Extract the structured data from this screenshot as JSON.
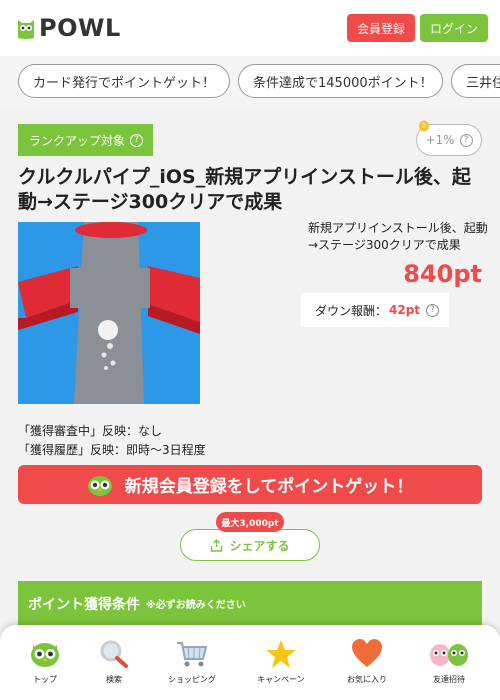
{
  "header": {
    "logo_text": "POWL",
    "register_label": "会員登録",
    "login_label": "ログイン"
  },
  "campaigns": [
    "カード発行でポイントゲット！",
    "条件達成で145000ポイント！",
    "三井住"
  ],
  "offer": {
    "rank_badge": "ランクアップ対象",
    "bonus_pill": "+1%",
    "title": "クルクルパイプ_iOS_新規アプリインストール後、起動→ステージ300クリアで成果",
    "description": "新規アプリインストール後、起動→ステージ300クリアで成果",
    "points": "840pt",
    "down_label": "ダウン報酬：",
    "down_value": "42pt",
    "status_pending": "「獲得審査中」反映：なし",
    "status_history": "「獲得履歴」反映：即時〜3日程度",
    "cta_label": "新規会員登録をしてポイントゲット！",
    "share_badge": "最大3,000pt",
    "share_label": "シェアする"
  },
  "conditions": {
    "title": "ポイント獲得条件",
    "note": "※必ずお読みください"
  },
  "bottom_nav": {
    "top": "トップ",
    "search": "検索",
    "shopping": "ショッピング",
    "campaign": "キャンペーン",
    "favorites": "お気に入り",
    "invite": "友達招待"
  },
  "colors": {
    "red": "#f04a4a",
    "green": "#7cc43b"
  }
}
